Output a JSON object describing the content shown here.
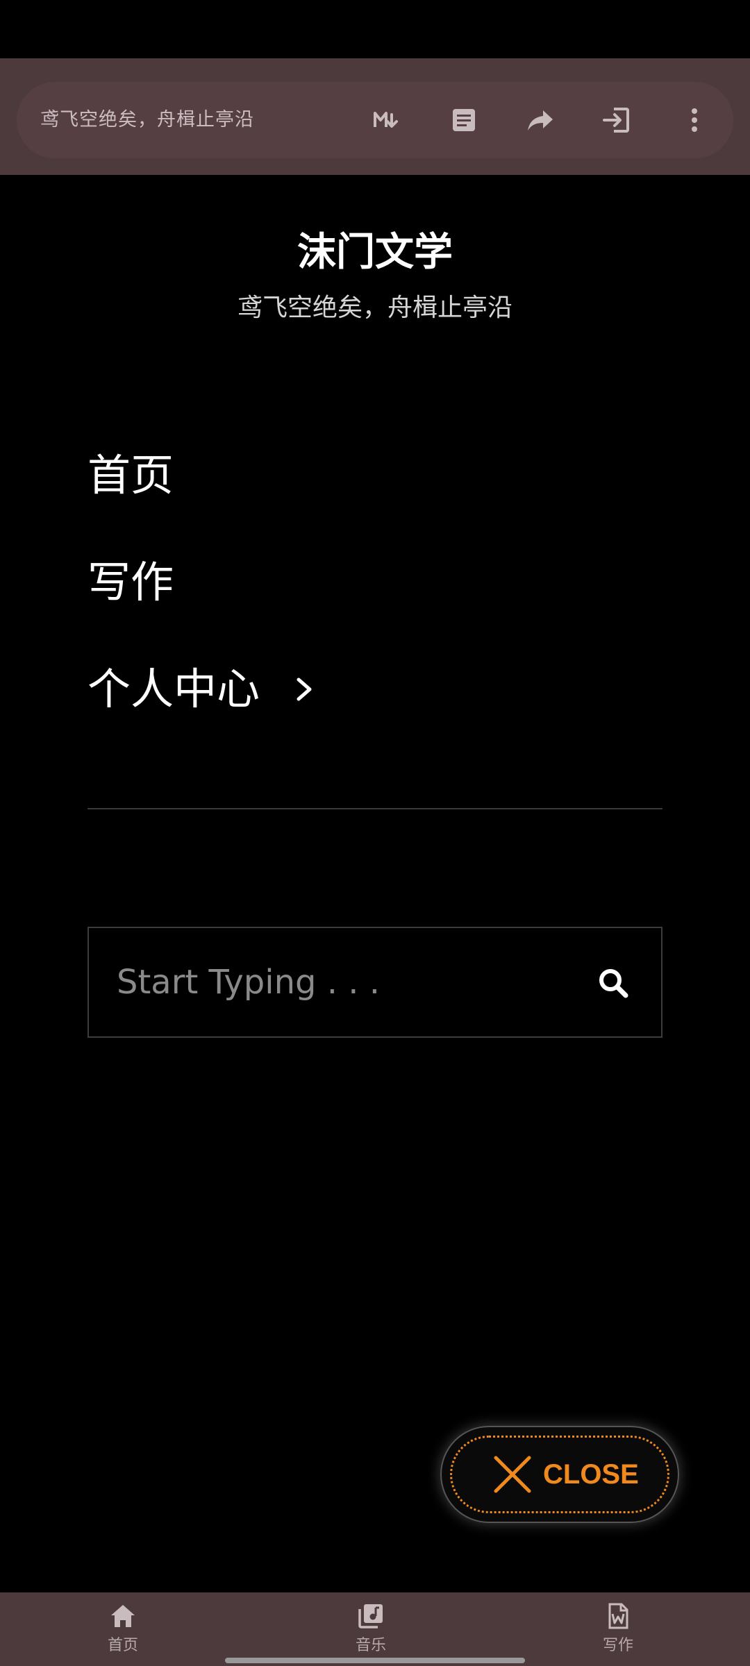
{
  "topbar": {
    "title": "鸢飞空绝矣，舟楫止亭沿",
    "icons": [
      "markdown-icon",
      "article-icon",
      "share-icon",
      "exit-icon",
      "more-vertical-icon"
    ]
  },
  "site": {
    "title": "沫门文学",
    "subtitle": "鸢飞空绝矣，舟楫止亭沿"
  },
  "menu": {
    "items": [
      {
        "label": "首页"
      },
      {
        "label": "写作"
      },
      {
        "label": "个人中心"
      }
    ]
  },
  "search": {
    "placeholder": "Start Typing . . ."
  },
  "close": {
    "label": "CLOSE",
    "color": "#f08a1c"
  },
  "bottom_nav": {
    "items": [
      {
        "label": "首页",
        "icon": "home-icon"
      },
      {
        "label": "音乐",
        "icon": "music-library-icon"
      },
      {
        "label": "写作",
        "icon": "word-document-icon"
      }
    ]
  },
  "colors": {
    "bar_background": "#4d3a3d",
    "background": "#000000"
  }
}
